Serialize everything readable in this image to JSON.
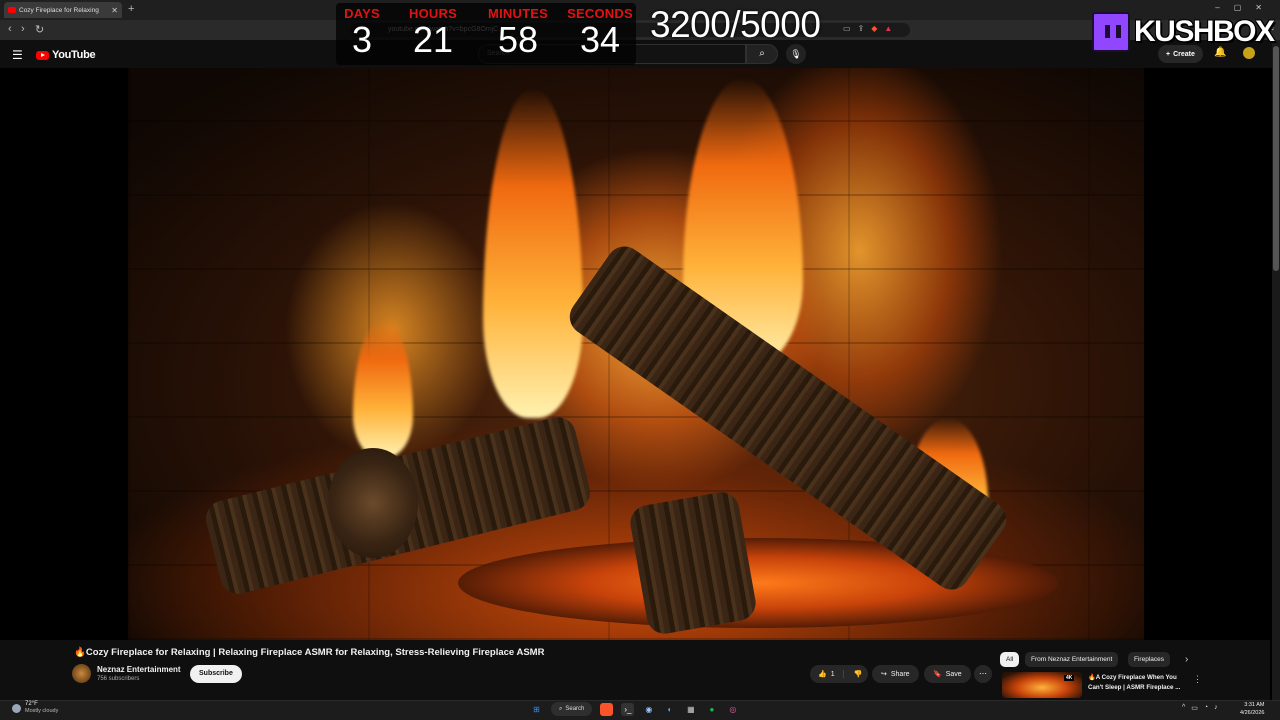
{
  "browser": {
    "tab_title": "Cozy Fireplace for Relaxing",
    "new_tab": "+",
    "url": "youtube.com/watch?v=bpcG8OmjC",
    "window_controls": [
      "–",
      "▢",
      "✕"
    ]
  },
  "youtube": {
    "logo_text": "YouTube",
    "search_placeholder": "Search",
    "create_label": "Create",
    "video": {
      "title": "🔥Cozy Fireplace for Relaxing | Relaxing Fireplace ASMR for Relaxing, Stress-Relieving Fireplace ASMR",
      "channel_name": "Neznaz Entertainment",
      "subscribers": "756 subscribers",
      "subscribe_label": "Subscribe",
      "like_count": "1",
      "share_label": "Share",
      "save_label": "Save"
    },
    "chips": [
      "All",
      "From Neznaz Entertainment",
      "Fireplaces"
    ],
    "recommendation": {
      "title": "🔥A Cozy Fireplace When You Can't Sleep | ASMR Fireplace ...",
      "badge": "4K"
    }
  },
  "overlay": {
    "countdown": [
      {
        "label": "DAYS",
        "value": "3"
      },
      {
        "label": "HOURS",
        "value": "21"
      },
      {
        "label": "MINUTES",
        "value": "58"
      },
      {
        "label": "SECONDS",
        "value": "34"
      }
    ],
    "goal": "3200/5000",
    "brand": "KUSHBOX"
  },
  "taskbar": {
    "weather_temp": "72°F",
    "weather_condition": "Mostly cloudy",
    "search_label": "Search",
    "time": "3:31 AM",
    "date": "4/26/2026"
  },
  "colors": {
    "countdown_label": "#e01313",
    "twitch": "#9146ff",
    "youtube_red": "#ff0000"
  }
}
